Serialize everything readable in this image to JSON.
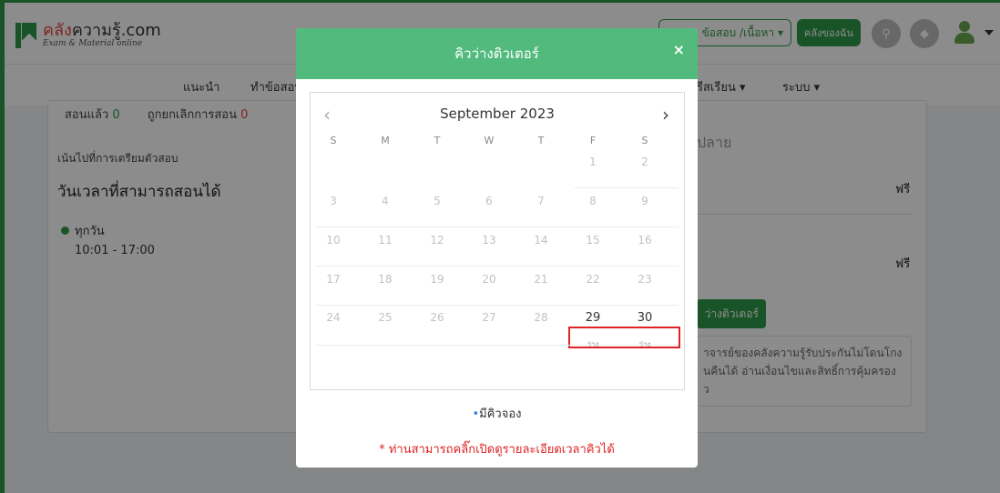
{
  "header": {
    "logo_brand_red": "คลัง",
    "logo_brand_rest": "ความรู้.com",
    "logo_tagline": "Exam & Material online",
    "search_label": "ข้อสอบ /เนื้อหา ▾",
    "my_library_label": "คลังของฉัน"
  },
  "menu": {
    "items": [
      "แนะนำ",
      "ทำข้อสอบ",
      "รีสเรียน ▾",
      "ระบบ ▾"
    ]
  },
  "background": {
    "stat_taught_label": "สอนแล้ว",
    "stat_taught_value": "0",
    "stat_cancel_label": "ถูกยกเลิกการสอน",
    "stat_cancel_value": "0",
    "focus_label": "เน้นไปที่การเตรียมตัวสอบ",
    "avail_title": "วันเวลาที่สามารถสอนได้",
    "schedule_day": "ทุกวัน",
    "schedule_time": "10:01 - 17:00",
    "right_title": "ปลาย",
    "free_1": "ฟรี",
    "free_2": "ฟรี",
    "tutor_button": "ว่างติวเตอร์",
    "guarantee_line1": "าจารย์ของคลังความรู้รับประกันไม่โดนโกง",
    "guarantee_line2": "นคืนได้ อ่านเงื่อนไขและสิทธิ์การคุ้มครอง",
    "guarantee_line3": "ว"
  },
  "modal": {
    "title": "คิวว่างติวเตอร์",
    "close_glyph": "×",
    "prev_glyph": "‹",
    "next_glyph": "›",
    "legend_text": "มีคิวจอง",
    "hint_text": "* ท่านสามารถคลิ๊กเปิดดูรายละเอียดเวลาคิวได้"
  },
  "calendar": {
    "month_title": "September 2023",
    "weekdays": [
      "S",
      "M",
      "T",
      "W",
      "T",
      "F",
      "S"
    ],
    "days": [
      "1",
      "2",
      "3",
      "4",
      "5",
      "6",
      "7",
      "8",
      "9",
      "10",
      "11",
      "12",
      "13",
      "14",
      "15",
      "16",
      "17",
      "18",
      "19",
      "20",
      "21",
      "22",
      "23",
      "24",
      "25",
      "26",
      "27",
      "28",
      "29",
      "30"
    ],
    "available_days": [
      "29",
      "30"
    ],
    "slot_label": "ว่าง"
  },
  "colors": {
    "brand_green": "#2f9a4a",
    "modal_header": "#51ba7c",
    "highlight_red": "#e02424"
  }
}
